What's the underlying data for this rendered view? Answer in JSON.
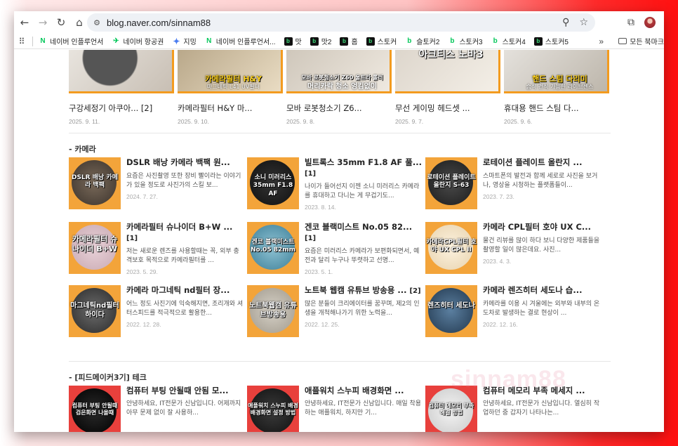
{
  "browser": {
    "url": "blog.naver.com/sinnam88",
    "bookmarks": [
      {
        "label": "네이버 인플루언서",
        "icon": "naver-n-icon"
      },
      {
        "label": "네이버 항공권",
        "icon": "plane-icon"
      },
      {
        "label": "지밍",
        "icon": "gemini-star-icon"
      },
      {
        "label": "네이버 인플루언서...",
        "icon": "naver-n-icon"
      },
      {
        "label": "맛",
        "icon": "blog-icon"
      },
      {
        "label": "맛2",
        "icon": "blog-icon"
      },
      {
        "label": "홈",
        "icon": "blog-icon"
      },
      {
        "label": "스토커",
        "icon": "blog-icon"
      },
      {
        "label": "슬토커2",
        "icon": "blog-icon"
      },
      {
        "label": "스토커3",
        "icon": "blog-icon"
      },
      {
        "label": "스토커4",
        "icon": "blog-icon"
      },
      {
        "label": "스토커5",
        "icon": "blog-icon"
      }
    ],
    "more_label": "»",
    "all_bookmarks": "모든 북마크"
  },
  "top_tiles": [
    {
      "title": "구강세정기 아쿠아... [2]",
      "date": "2025. 9. 11.",
      "cap": "",
      "sub": ""
    },
    {
      "title": "카메라필터 H&Y 마...",
      "date": "2025. 9. 10.",
      "cap": "카메라필터 H&Y",
      "sub": "마그네틱 L41 UV필터"
    },
    {
      "title": "모바 로봇청소기 Z6...",
      "date": "2025. 9. 8.",
      "cap": "모바 로봇청소기 Z60 울트라 롤러",
      "sub": "머리카락 청소 엉킴없이"
    },
    {
      "title": "무선 게이밍 헤드셋 ...",
      "date": "2025. 9. 7.",
      "cap": "아크티스 노바3",
      "sub": ""
    },
    {
      "title": "휴대용 핸드 스팀 다...",
      "date": "2025. 9. 6.",
      "cap": "핸드 스팀 다리미",
      "sub": "습식 건식 가능한 라이브센스"
    }
  ],
  "sections": [
    {
      "title": "- 카메라",
      "posts": [
        {
          "title": "DSLR 배낭 카메라 백팩 원...",
          "count": "",
          "excerpt": "요즘은 사진촬영 또한 장비 빨이라는 이야기가 있을 정도로 사진가의 스킬 보...",
          "date": "2024. 7. 27.",
          "thumb": "DSLR 배낭 카메라 백팩"
        },
        {
          "title": "빌트록스 35mm F1.8 AF 풀... ",
          "count": "[1]",
          "excerpt": "나이가 들어선지 이젠 소니 미러리스 카메라를 휴대하고 다니는 게 무겁기도...",
          "date": "2023. 8. 14.",
          "thumb": "소니 미러리스 35mm F1.8 AF"
        },
        {
          "title": "로테이션 플레이트 올란지 ...",
          "count": "",
          "excerpt": "스마트폰의 발전과 함께 세로로 사진을 보거나, 영상을 시청하는 플랫폼들이...",
          "date": "2023. 7. 23.",
          "thumb": "로테이션 플레이트 올란지 S-63"
        },
        {
          "title": "카메라필터 슈나이더 B+W ... ",
          "count": "[1]",
          "excerpt": "저는 새로운 렌즈를 사용할때는 꼭, 외부 충격보호 목적으로 카메라필터를 ...",
          "date": "2023. 5. 29.",
          "thumb": "카메라필터 슈나이더 B+W"
        },
        {
          "title": "겐코 블랙미스트 No.05 82... ",
          "count": "[1]",
          "excerpt": "요즘은 미러리스 카메라가 보편화되면서, 예전과 달리 누구나 뚜렷하고 선명...",
          "date": "2023. 5. 1.",
          "thumb": "겐코 블랙미스트 No.05 82mm"
        },
        {
          "title": "카메라 CPL필터 호야 UX C...",
          "count": "",
          "excerpt": "물건 리뷰를 많이 하다 보니 다양한 제품들을 촬영할 일이 많은데요. 사진...",
          "date": "2023. 4. 3.",
          "thumb": "카메라CPL필터 호야 UX CPL II"
        },
        {
          "title": "카메라 마그네틱 nd필터 장...",
          "count": "",
          "excerpt": "어느 정도 사진기에 익숙해지면, 조리개와 셔터스피드를 적극적으로 활용한...",
          "date": "2022. 12. 28.",
          "thumb": "마그네틱nd필터 하이다"
        },
        {
          "title": "노트북 웹캠 유튜브 방송용 ... ",
          "count": "[2]",
          "excerpt": "많은 분들이 크리에이터를 꿈꾸며, 제2의 인생을 개척해나가기 위한 노력을...",
          "date": "2022. 12. 25.",
          "thumb": "노트북웹캠 유튜브방송용"
        },
        {
          "title": "카메라 렌즈히터 세도나 습...",
          "count": "",
          "excerpt": "카메라를 이용 시 겨울에는 외부와 내부의 온도차로 발생하는 결로 현상이 ...",
          "date": "2022. 12. 16.",
          "thumb": "렌즈히터 세도나"
        }
      ]
    },
    {
      "title": "- [피드메이커3기] 테크",
      "posts": [
        {
          "title": "컴퓨터 부팅 안될때 안됨 모...",
          "count": "",
          "excerpt": "안녕하세요, IT전문가 신남입니다. 어제까지 아무 문제 없이 잘 사용하...",
          "date": "",
          "thumb": "컴퓨터 부팅 안될때 검은화면 나올때"
        },
        {
          "title": "애플워치 스누피 배경화면 ...",
          "count": "",
          "excerpt": "안녕하세요, IT전문가 신남입니다. 매일 착용하는 애플워치, 하지만 기...",
          "date": "",
          "thumb": "애플워치 스누피 배경 배경화면 설정 방법"
        },
        {
          "title": "컴퓨터 메모리 부족 메세지 ...",
          "count": "",
          "excerpt": "안녕하세요, IT전문가 신남입니다. 열심히 작업하던 중 갑자기 나타나는...",
          "date": "",
          "thumb": "컴퓨터 메모리 부족 해결 방법"
        }
      ]
    }
  ],
  "watermark": "sinnam88",
  "colors": {
    "accent": "#f39b1f",
    "naver_green": "#03c75a"
  }
}
